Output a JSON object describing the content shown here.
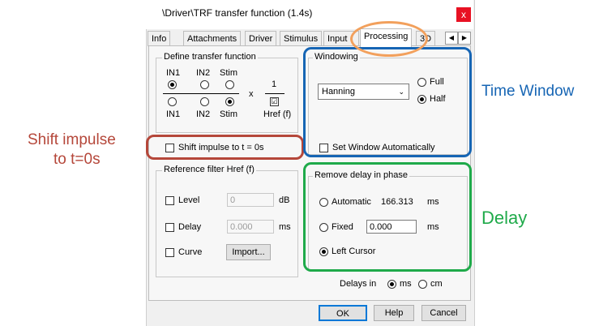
{
  "window": {
    "title": "\\Driver\\TRF transfer function (1.4s)",
    "close_label": "x"
  },
  "tabs": [
    {
      "label": "Info"
    },
    {
      "label": "Attachments"
    },
    {
      "label": "Driver"
    },
    {
      "label": "Stimulus"
    },
    {
      "label": "Input"
    },
    {
      "label": "Processing"
    },
    {
      "label": "3D"
    }
  ],
  "tab_nav": {
    "prev": "◀",
    "next": "▶"
  },
  "define_tf": {
    "group_label": "Define transfer function",
    "top_headers": [
      "IN1",
      "IN2",
      "Stim"
    ],
    "bottom_headers": [
      "IN1",
      "IN2",
      "Stim"
    ],
    "multiply": "x",
    "numerator": "1",
    "href_label": "Href (f)",
    "href_check": "☑"
  },
  "shift": {
    "label": "Shift impulse to t = 0s"
  },
  "ref_filter": {
    "group_label": "Reference filter Href (f)",
    "level_label": "Level",
    "level_value": "0",
    "level_unit": "dB",
    "delay_label": "Delay",
    "delay_value": "0.000",
    "delay_unit": "ms",
    "curve_label": "Curve",
    "import_label": "Import..."
  },
  "windowing": {
    "group_label": "Windowing",
    "selected": "Hanning",
    "full_label": "Full",
    "half_label": "Half",
    "auto_label": "Set Window Automatically"
  },
  "remove_delay": {
    "group_label": "Remove delay in phase",
    "automatic_label": "Automatic",
    "automatic_value": "166.313",
    "automatic_unit": "ms",
    "fixed_label": "Fixed",
    "fixed_value": "0.000",
    "fixed_unit": "ms",
    "cursor_label": "Left Cursor"
  },
  "delays_in": {
    "label": "Delays in",
    "ms": "ms",
    "cm": "cm"
  },
  "buttons": {
    "ok": "OK",
    "help": "Help",
    "cancel": "Cancel"
  },
  "annotations": {
    "shift_line1": "Shift impulse",
    "shift_line2": "to t=0s",
    "time_window": "Time Window",
    "delay": "Delay"
  },
  "colors": {
    "shift": "#b5473a",
    "time_window": "#1665b4",
    "delay": "#1faa4a",
    "tab_highlight": "#f2a05c"
  }
}
